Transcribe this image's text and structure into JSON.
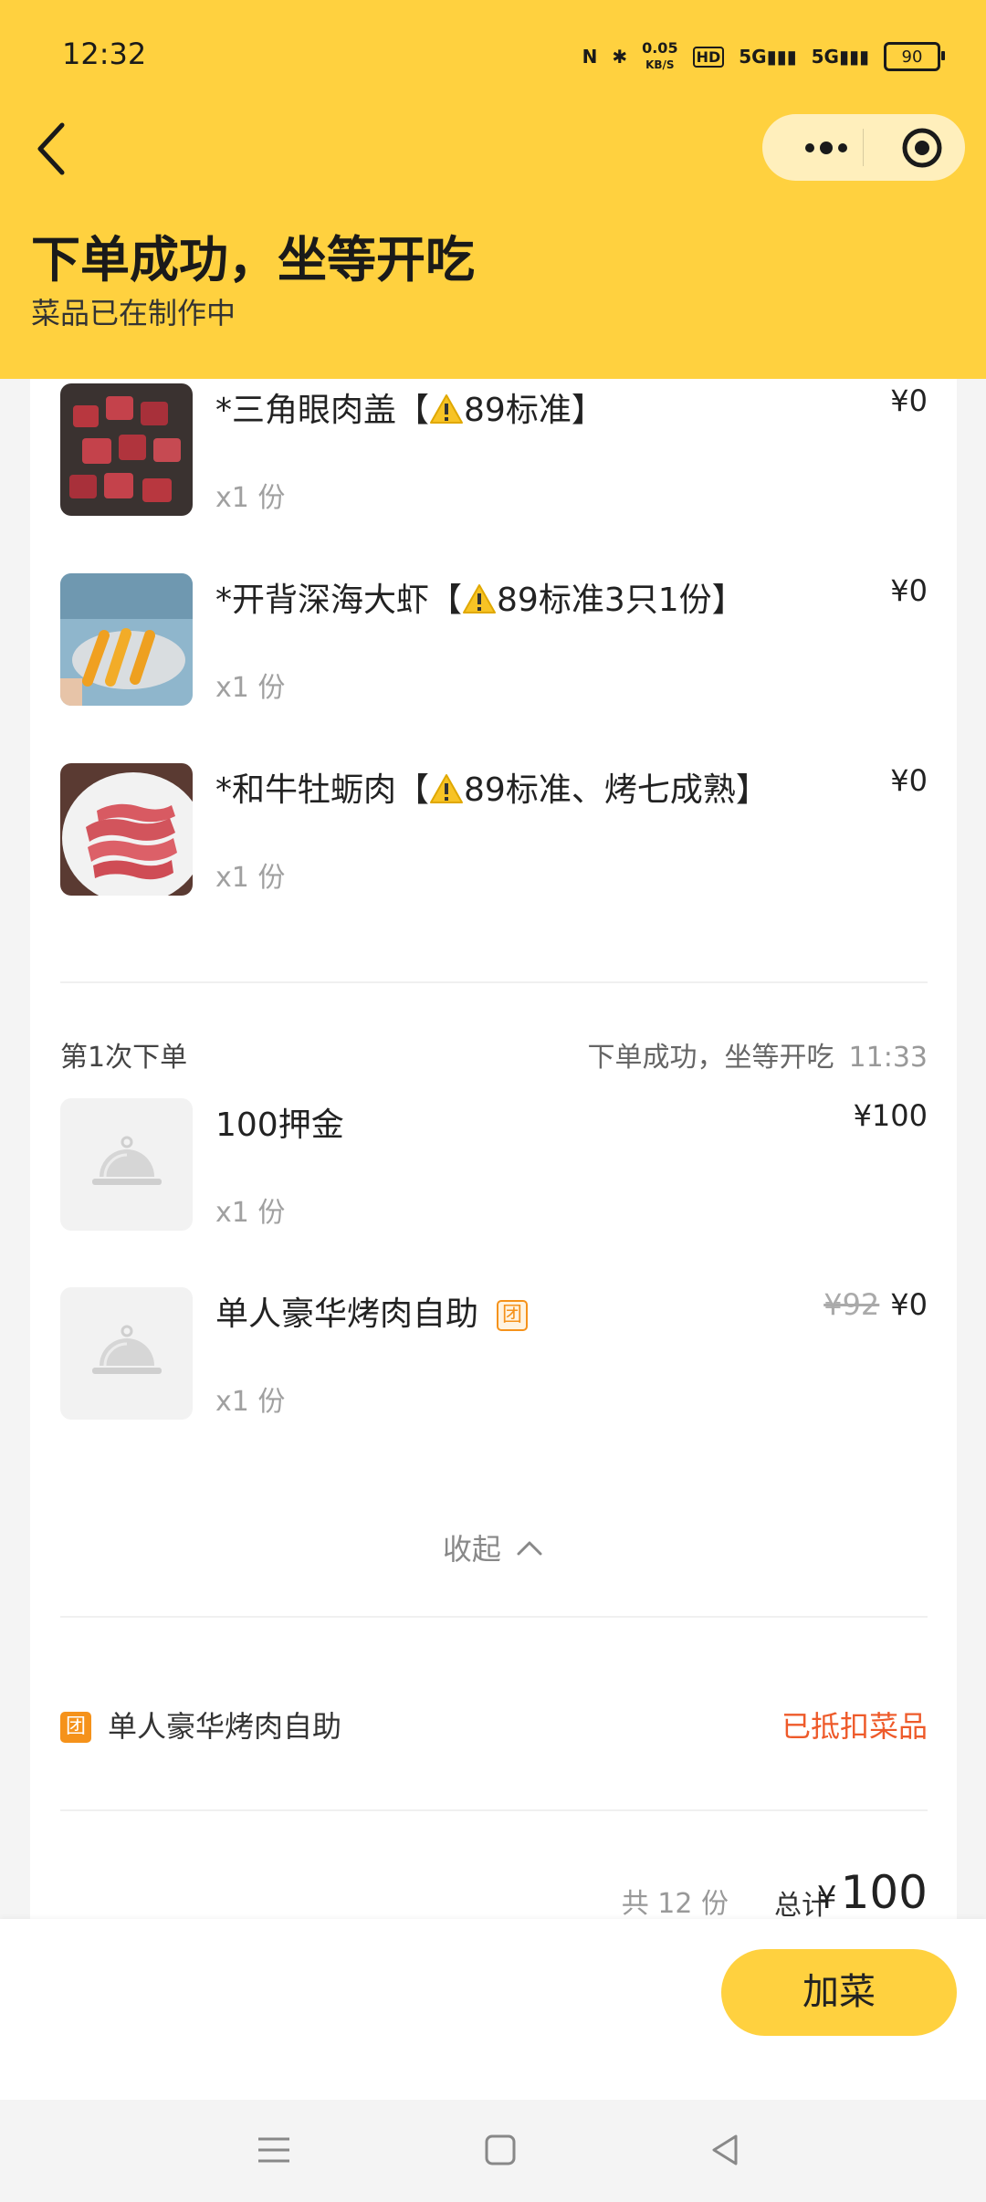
{
  "status_bar": {
    "time": "12:32",
    "speed_value": "0.05",
    "speed_unit": "KB/S",
    "hd_label": "HD",
    "sig1_label": "5G",
    "sig2_label": "5G",
    "battery": "90"
  },
  "header": {
    "title": "下单成功，坐等开吃",
    "subtitle": "菜品已在制作中"
  },
  "items_prev": [
    {
      "name_prefix": "*三角眼肉盖【",
      "name_suffix": "89标准】",
      "qty": "x1 份",
      "price": "¥0"
    },
    {
      "name_prefix": "*开背深海大虾【",
      "name_suffix": "89标准3只1份】",
      "qty": "x1 份",
      "price": "¥0"
    },
    {
      "name_prefix": "*和牛牡蛎肉【",
      "name_suffix": "89标准、烤七成熟】",
      "qty": "x1 份",
      "price": "¥0"
    }
  ],
  "order1": {
    "label": "第1次下单",
    "status": "下单成功，坐等开吃",
    "time": "11:33",
    "items": [
      {
        "name": "100押金",
        "qty": "x1 份",
        "price": "¥100"
      },
      {
        "name": "单人豪华烤肉自助",
        "badge": "团",
        "qty": "x1 份",
        "orig_price": "¥92",
        "price": "¥0"
      }
    ]
  },
  "collapse_label": "收起",
  "coupon": {
    "badge": "团",
    "name": "单人豪华烤肉自助",
    "status": "已抵扣菜品"
  },
  "summary": {
    "count": "共 12 份",
    "total_label": "总计",
    "currency": "¥",
    "total": "100"
  },
  "add_button": "加菜",
  "colors": {
    "brand_yellow": "#ffd13f",
    "deduct_red": "#ee5a2a",
    "tuan_orange": "#f5921b"
  }
}
